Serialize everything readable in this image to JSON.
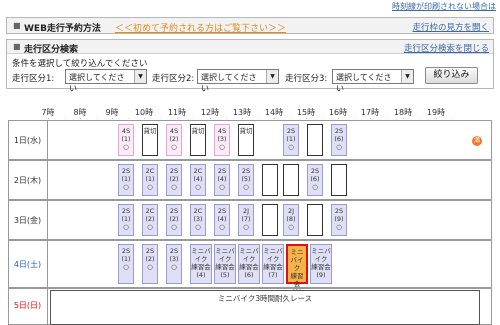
{
  "header": {
    "top_link": "時刻線が印刷されない場合は",
    "section1_mark": "■",
    "section1_title": "WEB走行予約方法",
    "section1_notice": "＜＜初めて予約される方はご覧下さい＞＞",
    "section1_right": "走行枠の見方を開く"
  },
  "filter": {
    "mark": "■",
    "title": "走行区分検索",
    "close_link": "走行区分検索を閉じる",
    "hint": "条件を選択して絞り込んでください",
    "labels": [
      "走行区分1:",
      "走行区分2:",
      "走行区分3:"
    ],
    "select_value": "選択してください",
    "button": "絞り込み"
  },
  "schedule": {
    "hours": [
      "7時",
      "8時",
      "9時",
      "10時",
      "11時",
      "12時",
      "13時",
      "14時",
      "15時",
      "16時",
      "17時",
      "18時",
      "19時"
    ],
    "days": [
      {
        "label": "1日(水)",
        "type": "weekday"
      },
      {
        "label": "2日(木)",
        "type": "weekday"
      },
      {
        "label": "3日(金)",
        "type": "weekday"
      },
      {
        "label": "4日(土)",
        "type": "sat"
      },
      {
        "label": "5日(日)",
        "type": "sun"
      }
    ],
    "row1": [
      {
        "text": "4S\n(1)\n○",
        "style": "pink"
      },
      {
        "text": "貸切",
        "style": "white"
      },
      {
        "text": "4S\n(2)\n○",
        "style": "pink"
      },
      {
        "text": "貸切",
        "style": "white"
      },
      {
        "text": "4S\n(3)\n○",
        "style": "pink"
      },
      {
        "text": "貸切",
        "style": "white"
      },
      {
        "text": "2S\n(1)\n○",
        "style": "blue"
      },
      {
        "text": "",
        "style": "white"
      },
      {
        "text": "2S\n(6)\n○",
        "style": "blue"
      }
    ],
    "row2": [
      {
        "text": "2S\n(1)\n○",
        "style": "blue"
      },
      {
        "text": "2C\n(1)\n○",
        "style": "blue"
      },
      {
        "text": "2S\n(2)\n○",
        "style": "blue"
      },
      {
        "text": "2C\n(4)\n○",
        "style": "blue"
      },
      {
        "text": "2S\n(4)\n○",
        "style": "blue"
      },
      {
        "text": "2S\n(5)\n○",
        "style": "blue"
      },
      {
        "text": "",
        "style": "white"
      },
      {
        "text": "",
        "style": "white"
      },
      {
        "text": "2S\n(6)\n○",
        "style": "blue"
      },
      {
        "text": "",
        "style": "white"
      }
    ],
    "row3": [
      {
        "text": "2S\n(1)\n○",
        "style": "blue"
      },
      {
        "text": "2C\n(2)\n○",
        "style": "blue"
      },
      {
        "text": "2S\n(2)\n○",
        "style": "blue"
      },
      {
        "text": "2C\n(3)\n○",
        "style": "blue"
      },
      {
        "text": "2S\n(4)\n○",
        "style": "blue"
      },
      {
        "text": "2J\n(7)\n○",
        "style": "blue"
      },
      {
        "text": "",
        "style": "white"
      },
      {
        "text": "2J\n(8)\n○",
        "style": "blue"
      },
      {
        "text": "",
        "style": "white"
      },
      {
        "text": "2S\n(9)\n○",
        "style": "blue"
      }
    ],
    "row4": [
      {
        "text": "2S\n(1)\n○",
        "style": "blue"
      },
      {
        "text": "2S\n(2)\n○",
        "style": "blue"
      },
      {
        "text": "2S\n(3)\n○",
        "style": "blue"
      },
      {
        "text": "ミニバイク\n練習会\n(4)",
        "style": "blue"
      },
      {
        "text": "ミニバイク\n練習会\n(5)",
        "style": "blue"
      },
      {
        "text": "ミニバイク\n練習会\n(6)",
        "style": "blue"
      },
      {
        "text": "ミニバイク\n練習会\n(7)",
        "style": "blue"
      },
      {
        "text": "ミニバイク\n練習会\n(8)",
        "style": "selected"
      },
      {
        "text": "ミニバイク\n練習会\n(9)",
        "style": "blue"
      }
    ],
    "row5_event": "ミニバイク3時間耐久レース",
    "side_icon": "満"
  },
  "colors": {
    "link": "#3a6aa8",
    "notice": "#e08a1c",
    "slot_blue": "#dfe0f5",
    "slot_pink": "#fbeaf7",
    "selected_border": "#e01010",
    "selected_fill": "#f5b44a"
  }
}
